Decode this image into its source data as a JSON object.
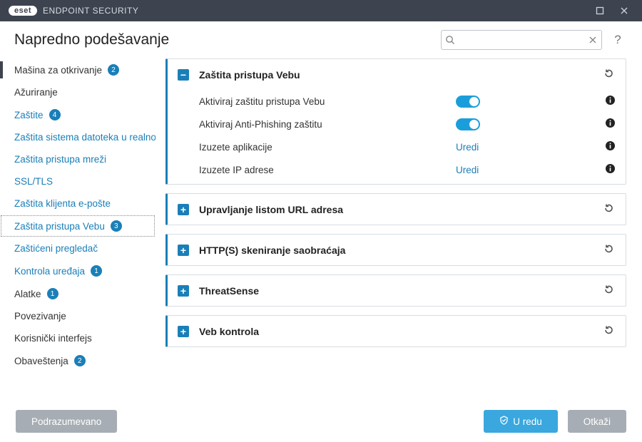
{
  "titlebar": {
    "brand": "eset",
    "product": "ENDPOINT SECURITY"
  },
  "page_title": "Napredno podešavanje",
  "search": {
    "value": "",
    "placeholder": ""
  },
  "sidebar": [
    {
      "label": "Mašina za otkrivanje",
      "badge": "2",
      "type": "top",
      "marked": true
    },
    {
      "label": "Ažuriranje",
      "type": "top"
    },
    {
      "label": "Zaštite",
      "badge": "4",
      "type": "top",
      "link": true
    },
    {
      "label": "Zaštita sistema datoteka u realnom vremenu",
      "type": "sub",
      "link": true
    },
    {
      "label": "Zaštita pristupa mreži",
      "type": "sub",
      "link": true
    },
    {
      "label": "SSL/TLS",
      "type": "sub",
      "link": true
    },
    {
      "label": "Zaštita klijenta e-pošte",
      "type": "sub",
      "link": true
    },
    {
      "label": "Zaštita pristupa Vebu",
      "badge": "3",
      "type": "sub",
      "link": true,
      "selected": true
    },
    {
      "label": "Zaštićeni pregledač",
      "type": "sub",
      "link": true
    },
    {
      "label": "Kontrola uređaja",
      "badge": "1",
      "type": "sub",
      "link": true
    },
    {
      "label": "Alatke",
      "badge": "1",
      "type": "top"
    },
    {
      "label": "Povezivanje",
      "type": "top"
    },
    {
      "label": "Korisnički interfejs",
      "type": "top"
    },
    {
      "label": "Obaveštenja",
      "badge": "2",
      "type": "top"
    }
  ],
  "panels": {
    "p0": {
      "title": "Zaštita pristupa Vebu",
      "expanded": true,
      "rows": [
        {
          "label": "Aktiviraj zaštitu pristupa Vebu",
          "control": "toggle",
          "value": true
        },
        {
          "label": "Aktiviraj Anti-Phishing zaštitu",
          "control": "toggle",
          "value": true
        },
        {
          "label": "Izuzete aplikacije",
          "control": "link",
          "link_text": "Uredi"
        },
        {
          "label": "Izuzete IP adrese",
          "control": "link",
          "link_text": "Uredi"
        }
      ]
    },
    "p1": {
      "title": "Upravljanje listom URL adresa",
      "expanded": false
    },
    "p2": {
      "title": "HTTP(S) skeniranje saobraćaja",
      "expanded": false
    },
    "p3": {
      "title": "ThreatSense",
      "expanded": false
    },
    "p4": {
      "title": "Veb kontrola",
      "expanded": false
    }
  },
  "footer": {
    "default": "Podrazumevano",
    "ok": "U redu",
    "cancel": "Otkaži"
  }
}
